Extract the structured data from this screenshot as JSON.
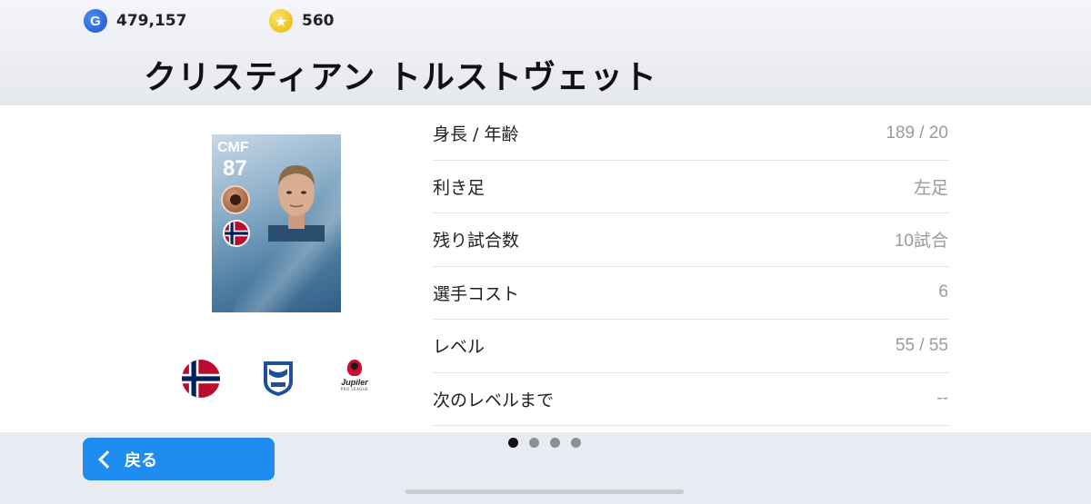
{
  "currency": {
    "gp_icon": "g-coin-icon",
    "gp_amount": "479,157",
    "coin_icon": "star-coin-icon",
    "coin_amount": "560"
  },
  "player": {
    "name": "クリスティアン トルストヴェット",
    "card": {
      "position": "CMF",
      "rating": "87"
    }
  },
  "stats": [
    {
      "label": "身長 / 年齢",
      "value": "189 / 20"
    },
    {
      "label": "利き足",
      "value": "左足"
    },
    {
      "label": "残り試合数",
      "value": "10試合"
    },
    {
      "label": "選手コスト",
      "value": "6"
    },
    {
      "label": "レベル",
      "value": "55 / 55"
    },
    {
      "label": "次のレベルまで",
      "value": "--"
    }
  ],
  "logos": {
    "league_name": "Jupiler",
    "league_sub": "PRO LEAGUE"
  },
  "nav": {
    "back_label": "戻る"
  },
  "pagination": {
    "total": 4,
    "active": 1
  },
  "colors": {
    "accent": "#1e8cf0",
    "value_text": "#9a9a9a"
  }
}
